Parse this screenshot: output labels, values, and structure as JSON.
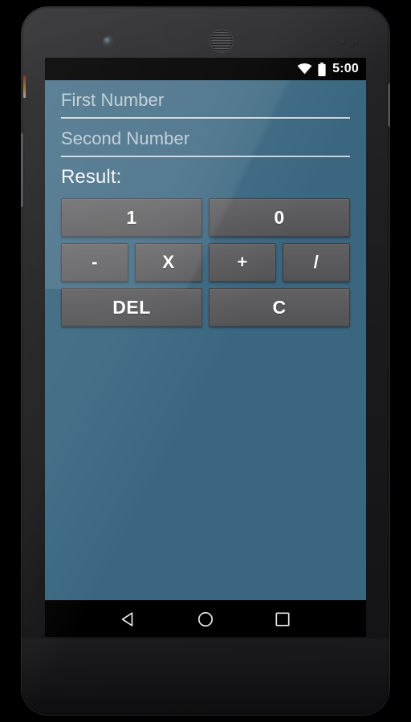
{
  "device": {
    "hardware": {
      "front_camera": "front-camera",
      "earpiece": "earpiece-speaker",
      "sensor_1": "proximity-sensor",
      "sensor_2": "ambient-light-sensor",
      "power_button": "power-button",
      "volume_button": "volume-rocker",
      "notification_led": "notification-led"
    }
  },
  "statusbar": {
    "wifi_icon": "wifi-icon",
    "battery_icon": "battery-icon",
    "time": "5:00",
    "background": "#000000",
    "foreground": "#ffffff"
  },
  "app": {
    "background": "#3a6680",
    "first_number": {
      "placeholder": "First Number",
      "value": ""
    },
    "second_number": {
      "placeholder": "Second Number",
      "value": ""
    },
    "result": {
      "label": "Result:",
      "value": ""
    },
    "keypad": {
      "rows": [
        {
          "keys": [
            {
              "label": "1",
              "name": "key-one"
            },
            {
              "label": "0",
              "name": "key-zero"
            }
          ]
        },
        {
          "keys": [
            {
              "label": "-",
              "name": "key-minus"
            },
            {
              "label": "X",
              "name": "key-multiply"
            },
            {
              "label": "+",
              "name": "key-plus"
            },
            {
              "label": "/",
              "name": "key-divide"
            }
          ]
        },
        {
          "keys": [
            {
              "label": "DEL",
              "name": "key-delete"
            },
            {
              "label": "C",
              "name": "key-clear"
            }
          ]
        }
      ],
      "key_fill": "#5b5b5d",
      "key_text": "#ffffff"
    }
  },
  "navbar": {
    "background": "#000000",
    "back_icon": "back-triangle-icon",
    "home_icon": "home-circle-icon",
    "recents_icon": "recents-square-icon"
  }
}
